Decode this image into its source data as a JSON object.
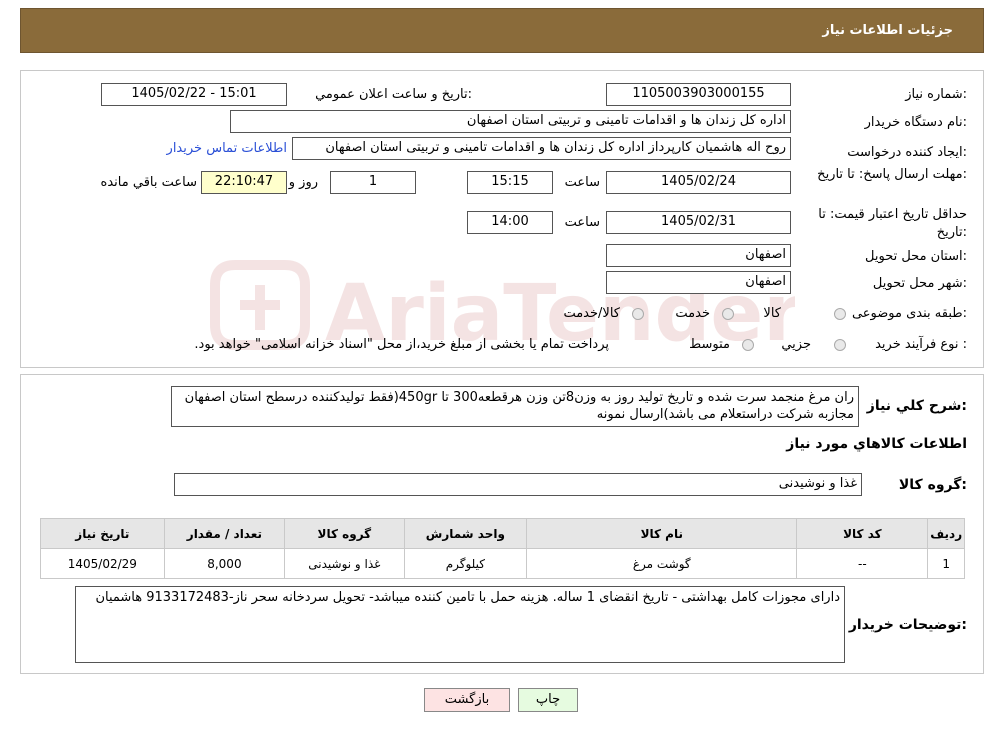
{
  "header": {
    "title": "جزئیات اطلاعات نیاز"
  },
  "form": {
    "need_number_label": "شماره نياز:",
    "need_number": "1105003903000155",
    "announce_label": "تاريخ و ساعت اعلان عمومي:",
    "announce_value": "1405/02/22 - 15:01",
    "buyer_org_label": "نام دستگاه خريدار:",
    "buyer_org": "اداره کل زندان ها و اقدامات تامینی و تربیتی استان اصفهان",
    "creator_label": "ايجاد کننده درخواست:",
    "creator": "روح اله هاشمیان کارپرداز اداره کل زندان ها و اقدامات تامینی و تربیتی استان اصفهان",
    "contact_link": "اطلاعات تماس خريدار",
    "reply_deadline_label": "مهلت ارسال پاسخ: تا تاريخ:",
    "reply_date": "1405/02/24",
    "time_label": "ساعت",
    "reply_time": "15:15",
    "days_value": "1",
    "days_label": "روز و",
    "remaining_time": "22:10:47",
    "remaining_label": "ساعت باقي مانده",
    "price_valid_label": "حداقل تاريخ اعتبار قيمت: تا تاريخ:",
    "price_valid_date": "1405/02/31",
    "price_valid_time": "14:00",
    "province_label": "استان محل تحويل:",
    "province": "اصفهان",
    "city_label": "شهر محل تحويل:",
    "city": "اصفهان",
    "category_label": "طبقه بندی موضوعی:",
    "category_options": [
      "کالا",
      "خدمت",
      "کالا/خدمت"
    ],
    "process_label": "نوع فرآيند خريد :",
    "process_options": [
      "جزيي",
      "متوسط"
    ],
    "process_note": "پرداخت تمام يا بخشی از مبلغ خريد،از محل \"اسناد خزانه اسلامی\" خواهد بود."
  },
  "description": {
    "label": "شرح کلي نياز:",
    "text": "ران مرغ منجمد سرت شده و تاریخ تولید روز به وزن8تن وزن هرقطعه300 تا 450gr(فقط تولیدکننده درسطح استان اصفهان مجازبه شرکت دراستعلام می باشد)ارسال نمونه"
  },
  "goods_info_title": "اطلاعات کالاهاي مورد نياز",
  "goods_group": {
    "label": "گروه کالا:",
    "value": "غذا و نوشیدنی"
  },
  "table": {
    "headers": [
      "رديف",
      "کد کالا",
      "نام کالا",
      "واحد شمارش",
      "گروه کالا",
      "تعداد / مقدار",
      "تاريخ نياز"
    ],
    "rows": [
      [
        "1",
        "--",
        "گوشت مرغ",
        "کیلوگرم",
        "غذا و نوشیدنی",
        "8,000",
        "1405/02/29"
      ]
    ]
  },
  "buyer_notes": {
    "label": "توضيحات خريدار:",
    "text": "دارای مجوزات کامل بهداشتی - تاریخ انقضای 1 ساله. هزینه حمل با تامین کننده میباشد- تحویل سردخانه سحر ناز-9133172483 هاشمیان"
  },
  "buttons": {
    "print": "چاپ",
    "back": "بازگشت"
  },
  "colors": {
    "header_bg": "#8a6b3a",
    "link": "#2a4fd6",
    "back_btn": "#fde3e3",
    "print_btn": "#e6fbe0"
  },
  "watermark": {
    "text": "AriaTender.neT"
  }
}
